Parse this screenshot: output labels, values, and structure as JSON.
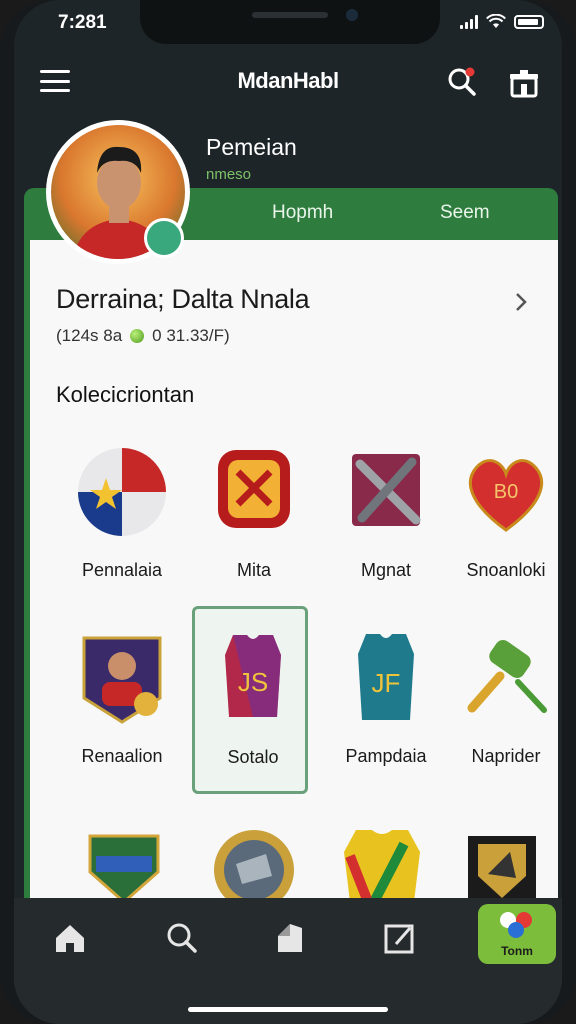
{
  "status": {
    "time": "7:281"
  },
  "app": {
    "title": "MdanHabl"
  },
  "profile": {
    "name": "Pemeian",
    "subtitle": "nmeso"
  },
  "tabs": [
    {
      "label": "Hopmh"
    },
    {
      "label": "Seem"
    }
  ],
  "card": {
    "title": "Derraina; Dalta Nnala",
    "stats_prefix": "(124s 8a",
    "stats_value": "0 31.33/F)"
  },
  "collection": {
    "title": "Kolecicriontan",
    "items": [
      {
        "label": "Pennalaia",
        "icon": "soccer-ball-icon"
      },
      {
        "label": "Mita",
        "icon": "shield-emblem-icon"
      },
      {
        "label": "Mgnat",
        "icon": "crossed-hammer-icon"
      },
      {
        "label": "Snoanloki",
        "icon": "heart-badge-icon"
      },
      {
        "label": "Renaalion",
        "icon": "player-card-icon"
      },
      {
        "label": "Sotalo",
        "icon": "jersey-icon",
        "selected": true
      },
      {
        "label": "Pampdaia",
        "icon": "jersey-icon"
      },
      {
        "label": "Naprider",
        "icon": "trophy-hammer-icon"
      }
    ]
  },
  "nav": {
    "special_label": "Tonm"
  },
  "colors": {
    "accent": "#2e7d3e",
    "background": "#1e2528",
    "card": "#f7f8f7",
    "highlight": "#7cbd3c"
  }
}
